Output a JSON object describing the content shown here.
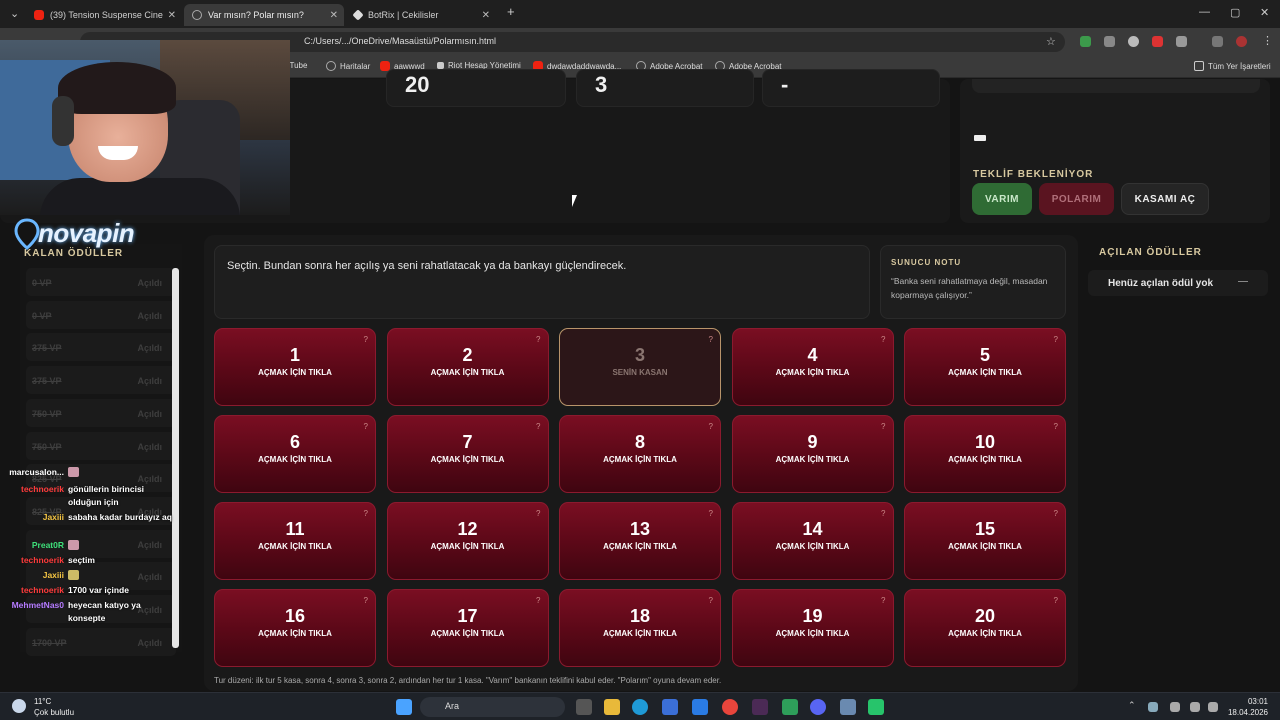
{
  "browser": {
    "tabs": [
      {
        "title": "(39) Tension Suspense Cine",
        "active": false
      },
      {
        "title": "Var mısın? Polar mısın?",
        "active": true
      },
      {
        "title": "BotRix | Cekilisler",
        "active": false
      }
    ],
    "url": "C:/Users/.../OneDrive/Masaüstü/Polarmısın.html",
    "bookmarks": [
      {
        "label": "YouTube",
        "icon": "youtube-icon"
      },
      {
        "label": "Haritalar",
        "icon": "maps-icon"
      },
      {
        "label": "aawwwd",
        "icon": "youtube-icon"
      },
      {
        "label": "Riot Hesap Yönetimi",
        "icon": "riot-icon"
      },
      {
        "label": "dwdawdaddwawda...",
        "icon": "youtube-icon"
      },
      {
        "label": "Adobe Acrobat",
        "icon": "globe-icon"
      },
      {
        "label": "Adobe Acrobat",
        "icon": "globe-icon"
      }
    ],
    "all_bookmarks": "Tüm Yer İşaretleri"
  },
  "top_cards": [
    "20",
    "3",
    "-"
  ],
  "offer": {
    "status": "TEKLİF BEKLENİYOR",
    "buttons": {
      "varim": "VARIM",
      "polarim": "POLARIM",
      "kasami_ac": "KASAMI AÇ"
    }
  },
  "message": "Seçtin. Bundan sonra her açılış ya seni rahatlatacak ya da bankayı güçlendirecek.",
  "host_note": {
    "title": "SUNUCU NOTU",
    "text": "“Banka seni rahatlatmaya değil, masadan koparmaya çalışıyor.”"
  },
  "boxes": [
    {
      "n": "1",
      "label": "AÇMAK İÇİN TIKLA",
      "mine": false
    },
    {
      "n": "2",
      "label": "AÇMAK İÇİN TIKLA",
      "mine": false
    },
    {
      "n": "3",
      "label": "SENİN KASAN",
      "mine": true
    },
    {
      "n": "4",
      "label": "AÇMAK İÇİN TIKLA",
      "mine": false
    },
    {
      "n": "5",
      "label": "AÇMAK İÇİN TIKLA",
      "mine": false
    },
    {
      "n": "6",
      "label": "AÇMAK İÇİN TIKLA",
      "mine": false
    },
    {
      "n": "7",
      "label": "AÇMAK İÇİN TIKLA",
      "mine": false
    },
    {
      "n": "8",
      "label": "AÇMAK İÇİN TIKLA",
      "mine": false
    },
    {
      "n": "9",
      "label": "AÇMAK İÇİN TIKLA",
      "mine": false
    },
    {
      "n": "10",
      "label": "AÇMAK İÇİN TIKLA",
      "mine": false
    },
    {
      "n": "11",
      "label": "AÇMAK İÇİN TIKLA",
      "mine": false
    },
    {
      "n": "12",
      "label": "AÇMAK İÇİN TIKLA",
      "mine": false
    },
    {
      "n": "13",
      "label": "AÇMAK İÇİN TIKLA",
      "mine": false
    },
    {
      "n": "14",
      "label": "AÇMAK İÇİN TIKLA",
      "mine": false
    },
    {
      "n": "15",
      "label": "AÇMAK İÇİN TIKLA",
      "mine": false
    },
    {
      "n": "16",
      "label": "AÇMAK İÇİN TIKLA",
      "mine": false
    },
    {
      "n": "17",
      "label": "AÇMAK İÇİN TIKLA",
      "mine": false
    },
    {
      "n": "18",
      "label": "AÇMAK İÇİN TIKLA",
      "mine": false
    },
    {
      "n": "19",
      "label": "AÇMAK İÇİN TIKLA",
      "mine": false
    },
    {
      "n": "20",
      "label": "AÇMAK İÇİN TIKLA",
      "mine": false
    }
  ],
  "box_hint": "?",
  "footer": "Tur düzeni: ilk tur 5 kasa, sonra 4, sonra 3, sonra 2, ardından her tur 1 kasa. \"Varım\" bankanın teklifini kabul eder. \"Polarım\" oyuna devam eder.",
  "opened": {
    "title": "AÇILAN ÖDÜLLER",
    "empty": "Henüz açılan ödül yok",
    "dash": "—"
  },
  "remaining": {
    "title": "KALAN ÖDÜLLER",
    "items": [
      {
        "value": "0 VP",
        "status": "Açıldı"
      },
      {
        "value": "0 VP",
        "status": "Açıldı"
      },
      {
        "value": "375 VP",
        "status": "Açıldı"
      },
      {
        "value": "375 VP",
        "status": "Açıldı"
      },
      {
        "value": "750 VP",
        "status": "Açıldı"
      },
      {
        "value": "750 VP",
        "status": "Açıldı"
      },
      {
        "value": "825 VP",
        "status": "Açıldı"
      },
      {
        "value": "825 VP",
        "status": "Açıldı"
      },
      {
        "value": "",
        "status": "Açıldı"
      },
      {
        "value": "",
        "status": "Açıldı"
      },
      {
        "value": "",
        "status": "Açıldı"
      },
      {
        "value": "1700 VP",
        "status": "Açıldı"
      }
    ]
  },
  "stream_logo": "novapin",
  "chat": [
    {
      "user": "marcusalon...",
      "text": "",
      "color": "#ffffff"
    },
    {
      "user": "technoerik",
      "text": "gönüllerin birincisi olduğun için",
      "color": "#ff3b3b"
    },
    {
      "user": "Jaxiii",
      "text": "sabaha kadar burdayız aq",
      "color": "#f5c542"
    },
    {
      "user": "Preat0R",
      "text": "",
      "color": "#3ee07a"
    },
    {
      "user": "technoerik",
      "text": "seçtim",
      "color": "#ff3b3b"
    },
    {
      "user": "Jaxiii",
      "text": "",
      "color": "#f5c542"
    },
    {
      "user": "technoerik",
      "text": "1700 var içinde",
      "color": "#ff3b3b"
    },
    {
      "user": "MehmetNas0",
      "text": "heyecan katıyo ya konsepte",
      "color": "#b57bff"
    }
  ],
  "taskbar": {
    "temp": "11°C",
    "weather": "Çok bulutlu",
    "search": "Ara",
    "time": "03:01",
    "date": "18.04.2026"
  }
}
